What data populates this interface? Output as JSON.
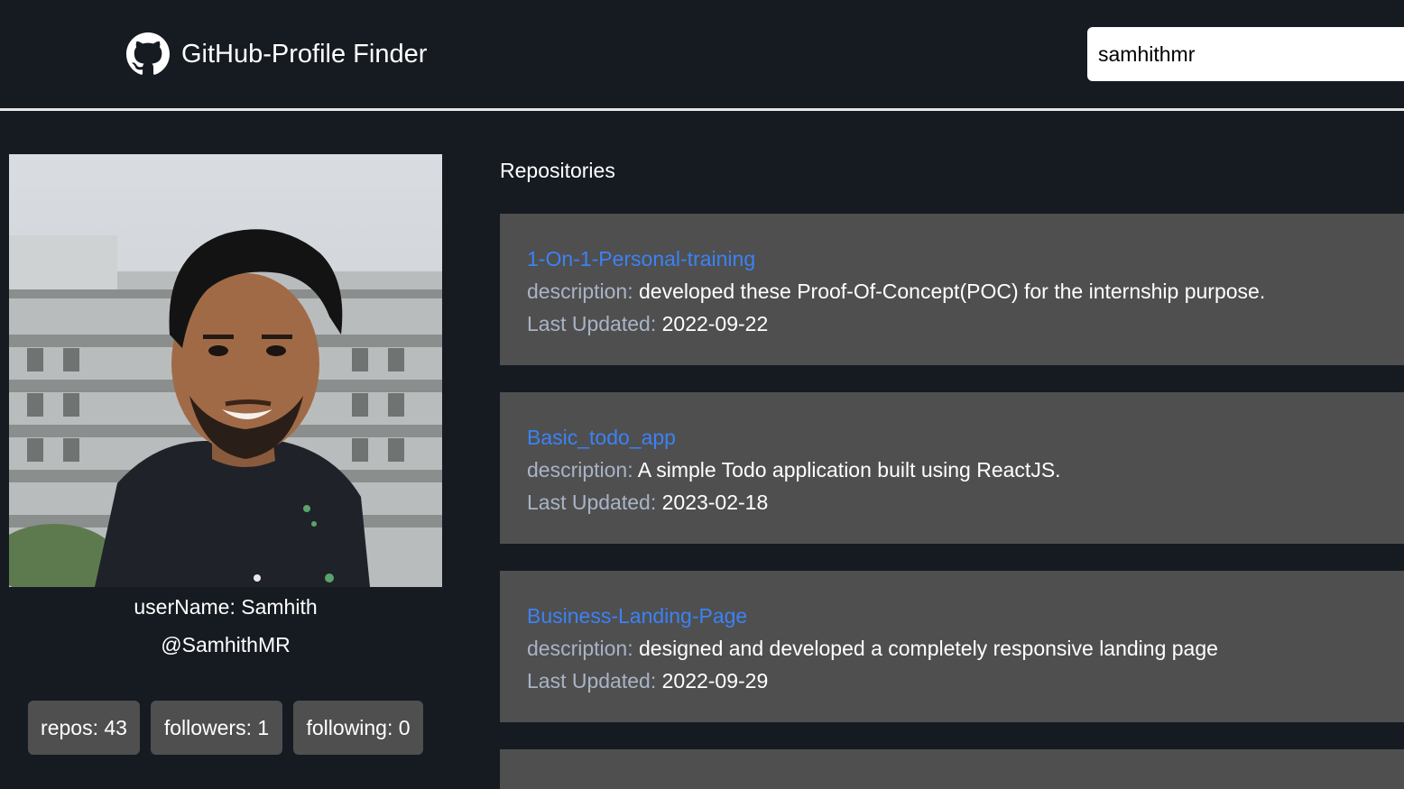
{
  "header": {
    "logo_icon": "github-octocat-icon",
    "title": "GitHub-Profile Finder",
    "search_value": "samhithmr"
  },
  "profile": {
    "avatar_alt": "profile-photo",
    "username_label": "userName:",
    "username": "Samhith",
    "handle": "@SamhithMR",
    "stats": {
      "repos": "repos: 43",
      "followers": "followers: 1",
      "following": "following: 0"
    }
  },
  "repositories": {
    "heading": "Repositories",
    "description_label": "description:",
    "updated_label": "Last Updated:",
    "items": [
      {
        "name": "1-On-1-Personal-training",
        "description": "developed these Proof-Of-Concept(POC) for the internship purpose.",
        "updated": "2022-09-22"
      },
      {
        "name": "Basic_todo_app",
        "description": "A simple Todo application built using ReactJS.",
        "updated": "2023-02-18"
      },
      {
        "name": "Business-Landing-Page",
        "description": "designed and developed a completely responsive landing page",
        "updated": "2022-09-29"
      }
    ]
  },
  "colors": {
    "background": "#161b22",
    "card": "#4f4f4f",
    "link": "#3b82f6",
    "muted_label": "#a9b3c6"
  }
}
